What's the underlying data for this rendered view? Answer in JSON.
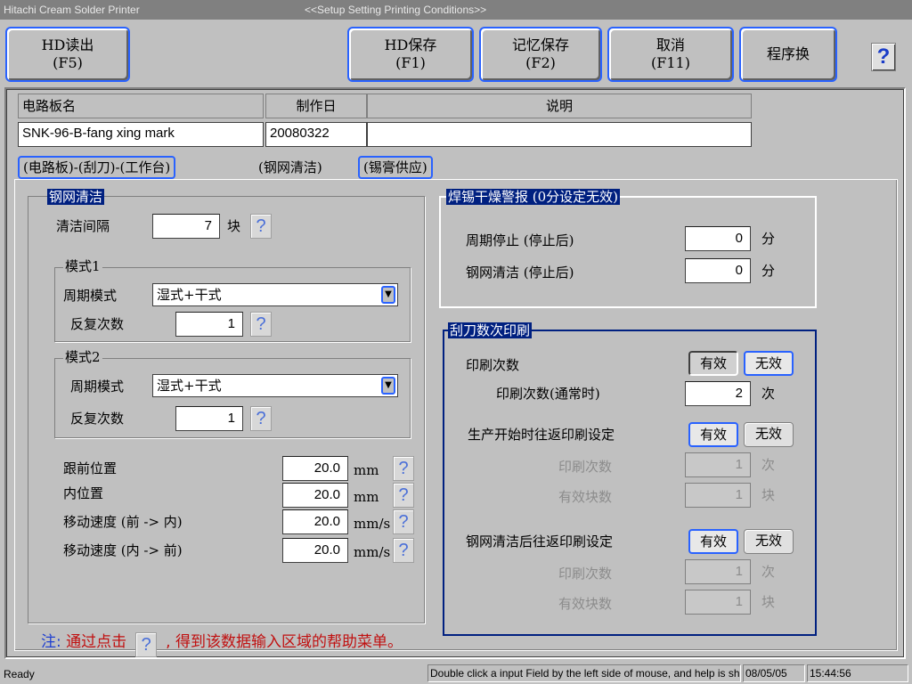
{
  "window": {
    "app_title": "Hitachi Cream Solder Printer",
    "screen_title": "<<Setup Setting Printing Conditions>>"
  },
  "toolbar": {
    "hd_read": [
      "HD读出",
      "(F5)"
    ],
    "hd_save": [
      "HD保存",
      "(F1)"
    ],
    "mem_save": [
      "记忆保存",
      "(F2)"
    ],
    "cancel": [
      "取消",
      "(F11)"
    ],
    "prog_switch": "程序换",
    "help": "?"
  },
  "header": {
    "col_board": "电路板名",
    "col_date": "制作日",
    "col_desc": "说明",
    "board_name": "SNK-96-B-fang xing mark",
    "date": "20080322",
    "description": ""
  },
  "tabs": [
    {
      "label": "(电路板)-(刮刀)-(工作台)",
      "active": false
    },
    {
      "label": "(钢网清洁)",
      "active": true
    },
    {
      "label": "(锡膏供应)",
      "active": false
    }
  ],
  "cleaning": {
    "title": "钢网清洁",
    "interval_label": "清洁间隔",
    "interval_value": "7",
    "interval_unit": "块",
    "mode1": {
      "title": "模式1",
      "cycle_label": "周期模式",
      "cycle_value": "湿式+干式",
      "repeat_label": "反复次数",
      "repeat_value": "1"
    },
    "mode2": {
      "title": "模式2",
      "cycle_label": "周期模式",
      "cycle_value": "湿式+干式",
      "repeat_label": "反复次数",
      "repeat_value": "1"
    },
    "positions": [
      {
        "label": "跟前位置",
        "value": "20.0",
        "unit": "mm"
      },
      {
        "label": "内位置",
        "value": "20.0",
        "unit": "mm"
      },
      {
        "label": "移动速度 (前  -> 内)",
        "value": "20.0",
        "unit": "mm/s"
      },
      {
        "label": "移动速度 (内  -> 前)",
        "value": "20.0",
        "unit": "mm/s"
      }
    ],
    "help_glyph": "?"
  },
  "dry_alarm": {
    "title": "焊锡干燥警报 (0分设定无效)",
    "cycle_stop_label": "周期停止 (停止后)",
    "cycle_stop_value": "0",
    "clean_label": "钢网清洁 (停止后)",
    "clean_value": "0",
    "unit": "分"
  },
  "squeegee": {
    "title": "刮刀数次印刷",
    "print_count_label": "印刷次数",
    "valid": "有效",
    "invalid": "无效",
    "normal_count_label": "印刷次数(通常时)",
    "normal_count_value": "2",
    "count_unit": "次",
    "start_label": "生产开始时往返印刷设定",
    "after_clean_label": "钢网清洁后往返印刷设定",
    "sub_count_label": "印刷次数",
    "sub_count_value": "1",
    "sub_blocks_label": "有效块数",
    "sub_blocks_value": "1",
    "block_unit": "块"
  },
  "note": {
    "prefix": "注:",
    "text1": "通过点击",
    "text2": ", 得到该数据输入区域的帮助菜单。"
  },
  "status": {
    "ready": "Ready",
    "hint": "Double click a input Field by the left side of mouse, and help is shown",
    "date": "08/05/05",
    "time": "15:44:56"
  }
}
